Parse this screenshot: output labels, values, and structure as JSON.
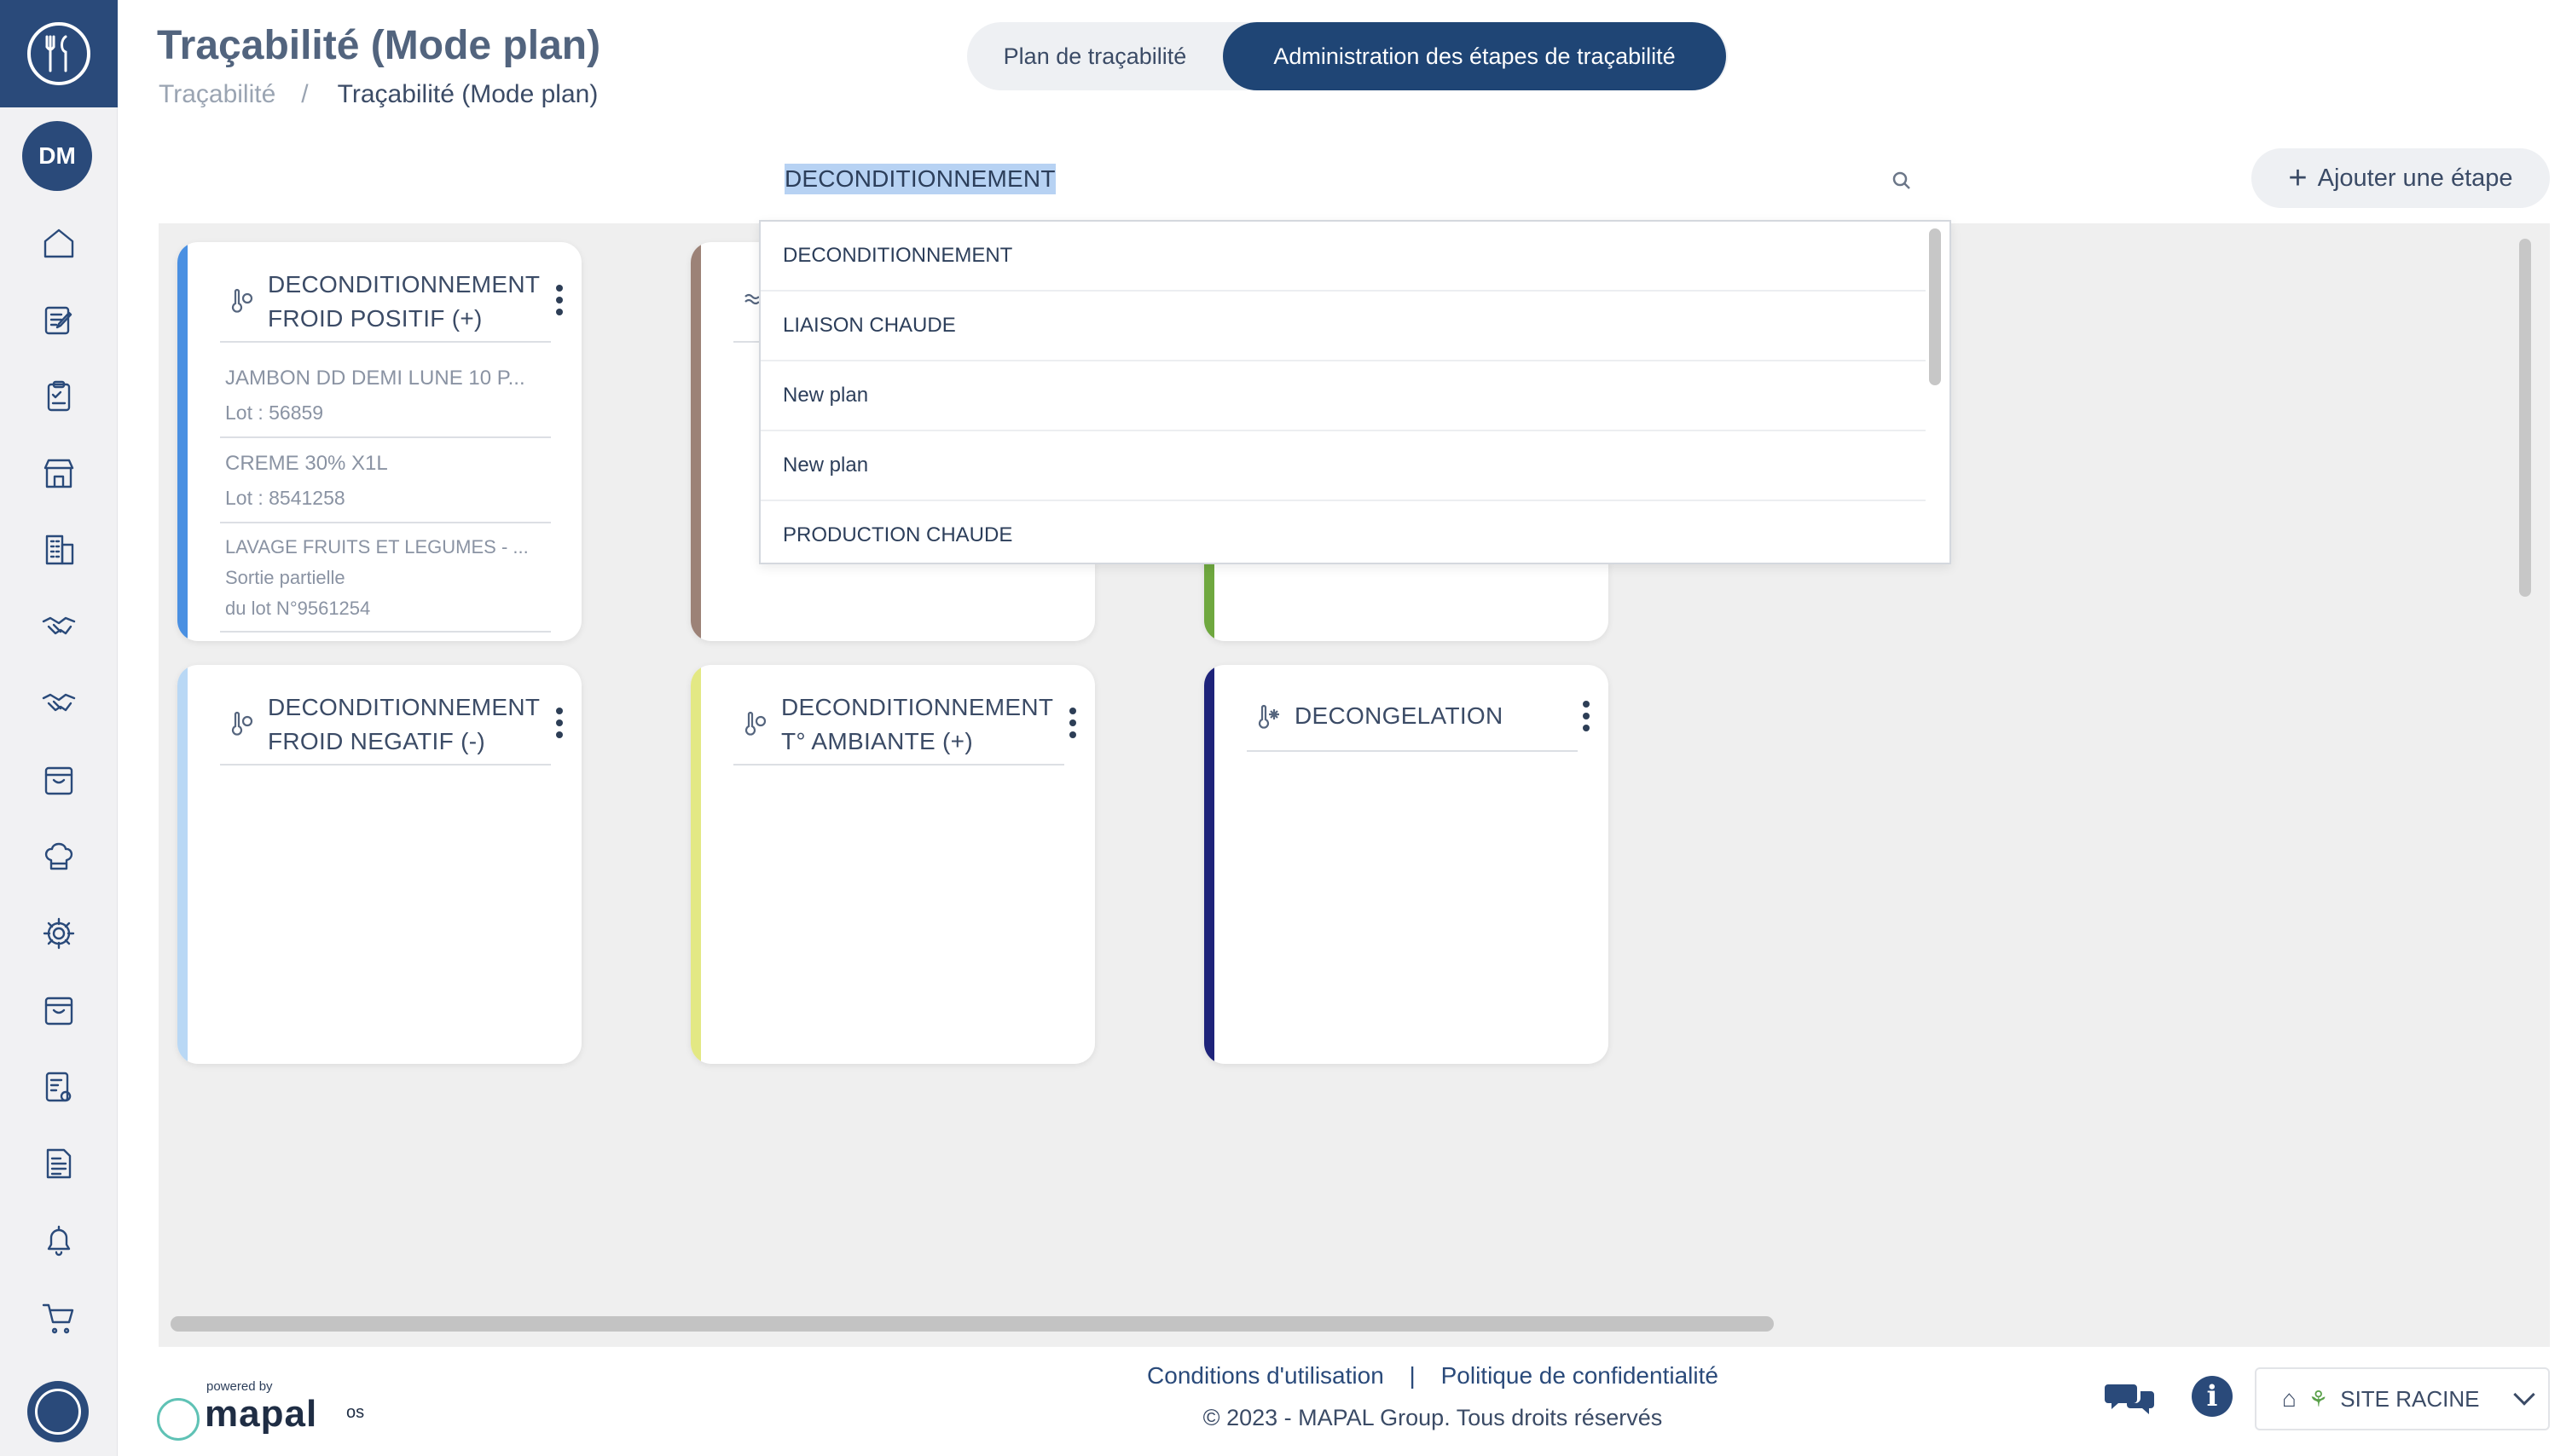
{
  "header": {
    "title": "Traçabilité (Mode plan)",
    "breadcrumb": {
      "root": "Traçabilité",
      "separator": "/",
      "current": "Traçabilité (Mode plan)"
    },
    "toggle": {
      "option1": "Plan de traçabilité",
      "option2": "Administration des étapes de traçabilité",
      "active": "option2"
    }
  },
  "sidebar": {
    "avatar": "DM",
    "icons": [
      "home-icon",
      "edit-icon",
      "clipboard-check-icon",
      "store-icon",
      "building-icon",
      "handshake-icon",
      "handshake-alt-icon",
      "box-icon",
      "chef-hat-icon",
      "gear-icon",
      "archive-icon",
      "checklist-icon",
      "document-icon",
      "bell-icon",
      "cart-icon"
    ]
  },
  "search": {
    "value": "DECONDITIONNEMENT"
  },
  "actions": {
    "add_step": "Ajouter une étape"
  },
  "dropdown": {
    "items": [
      "DECONDITIONNEMENT",
      "LIAISON CHAUDE",
      "New plan",
      "New plan",
      "PRODUCTION CHAUDE"
    ]
  },
  "cards": [
    {
      "title": "DECONDITIONNEMENT FROID POSITIF (+)",
      "color": "#4a90e2",
      "items": [
        {
          "name": "JAMBON DD DEMI LUNE 10 P...",
          "lot": "Lot : 56859"
        },
        {
          "name": "CREME 30% X1L",
          "lot": "Lot : 8541258"
        },
        {
          "name": "LAVAGE FRUITS ET LEGUMES - ...",
          "line2": "Sortie partielle",
          "line3": "du lot N°9561254"
        }
      ]
    },
    {
      "title": "",
      "color": "#9c8277",
      "items": []
    },
    {
      "title": "",
      "color": "#6fa83f",
      "items": []
    },
    {
      "title": "DECONDITIONNEMENT FROID NEGATIF (-)",
      "color": "#b9d8f5",
      "items": []
    },
    {
      "title": "DECONDITIONNEMENT T° AMBIANTE (+)",
      "color": "#e3e884",
      "items": []
    },
    {
      "title": "DECONGELATION",
      "color": "#1e237a",
      "items": []
    }
  ],
  "footer": {
    "powered_by": "powered by",
    "brand": "mapal",
    "brand_suffix": "os",
    "terms": "Conditions d'utilisation",
    "separator": "|",
    "privacy": "Politique de confidentialité",
    "copyright": "© 2023 - MAPAL Group. Tous droits réservés",
    "site": "SITE RACINE"
  },
  "colors": {
    "primary": "#2a4a7a",
    "active_toggle": "#1f4575",
    "board_bg": "#efefef"
  }
}
